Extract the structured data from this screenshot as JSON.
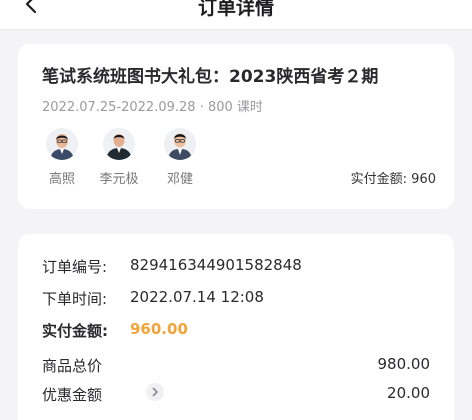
{
  "header": {
    "title": "订单详情"
  },
  "course": {
    "title": "笔试系统班图书大礼包：2023陕西省考２期",
    "meta": "2022.07.25-2022.09.28 · 800 课时",
    "teachers": [
      {
        "name": "高照"
      },
      {
        "name": "李元极"
      },
      {
        "name": "邓健"
      }
    ],
    "paid_summary": "实付金额: 960"
  },
  "order": {
    "number_label": "订单编号:",
    "number_value": "829416344901582848",
    "time_label": "下单时间:",
    "time_value": "2022.07.14 12:08",
    "paid_label": "实付金额:",
    "paid_value": "960.00",
    "total_label": "商品总价",
    "total_value": "980.00",
    "discount_label": "优惠金额",
    "discount_value": "20.00"
  },
  "colors": {
    "accent": "#f2a33a",
    "background": "#f4f4f6"
  },
  "icons": {
    "back": "chevron-left-icon",
    "discount_expand": "chevron-right-icon"
  }
}
